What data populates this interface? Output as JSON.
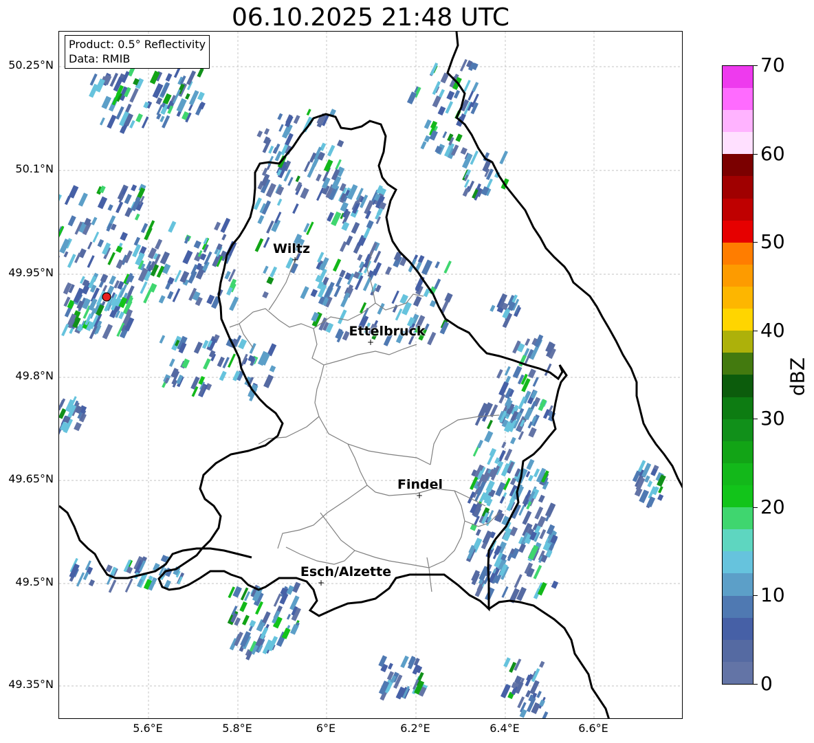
{
  "title": "06.10.2025 21:48 UTC",
  "info": {
    "product": "Product: 0.5° Reflectivity",
    "source": "Data: RMIB"
  },
  "lat_labels": [
    "50.25°N",
    "50.1°N",
    "49.95°N",
    "49.8°N",
    "49.65°N",
    "49.5°N",
    "49.35°N"
  ],
  "lon_labels": [
    "5.6°E",
    "5.8°E",
    "6°E",
    "6.2°E",
    "6.4°E",
    "6.6°E"
  ],
  "cities": [
    "Wiltz",
    "Ettelbruck",
    "Findel",
    "Esch/Alzette"
  ],
  "colorbar": {
    "unit": "dBZ",
    "ticks": [
      "0",
      "10",
      "20",
      "30",
      "40",
      "50",
      "60",
      "70"
    ],
    "colors": [
      "#6374a6",
      "#556aa2",
      "#4660a6",
      "#4f79b2",
      "#5c9fc8",
      "#66c3dd",
      "#5ed6c0",
      "#3fd66f",
      "#12c41a",
      "#13b81a",
      "#12a416",
      "#11901a",
      "#0d7c12",
      "#0c5c0c",
      "#437a0f",
      "#adb10a",
      "#ffd500",
      "#fdb600",
      "#fd9b00",
      "#ff7d00",
      "#e60000",
      "#bf0000",
      "#a00000",
      "#7b0000",
      "#ffe0ff",
      "#ffb3ff",
      "#ff6bff",
      "#ee3aee"
    ]
  },
  "radar_marker_color": "#e62020",
  "border_color": "#000000",
  "canton_color": "#808080"
}
